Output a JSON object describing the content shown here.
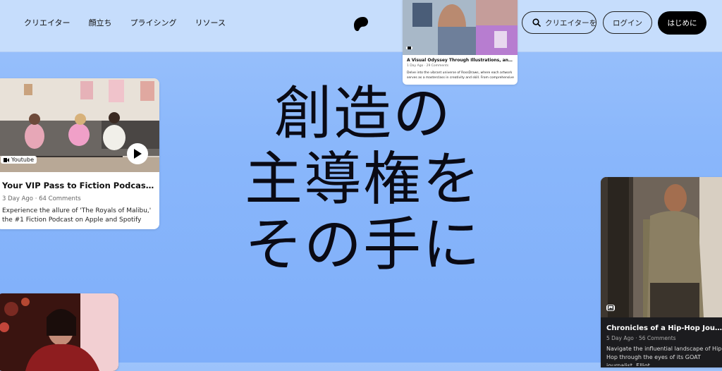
{
  "nav": {
    "items": [
      {
        "label": "クリエイター"
      },
      {
        "label": "顔立ち"
      },
      {
        "label": "プライシング"
      },
      {
        "label": "リソース"
      }
    ]
  },
  "header": {
    "search_placeholder": "クリエイターを...",
    "login_label": "ログイン",
    "start_label": "はじめに"
  },
  "hero": {
    "lines": [
      "創造の",
      "主導権を",
      "その手に"
    ]
  },
  "cards": {
    "left": {
      "badge": "Youtube",
      "title": "Your VIP Pass to Fiction Podcast Royalty",
      "meta": "3 Day Ago · 64 Comments",
      "desc": "Experience the allure of 'The Royals of Malibu,' the #1 Fiction Podcast on Apple and Spotify that keep..."
    },
    "top": {
      "badge": "",
      "title": "A Visual Odyssey Through Illustrations, and Character...",
      "meta": "1 Day Ago · 29 Comments",
      "desc": "Delve into the vibrant universe of RossDraws, where each artwork serves as a masterclass in creativity and skill. From comprehensive art courses..."
    },
    "right": {
      "title": "Chronicles of a Hip-Hop Journalis...",
      "meta": "5 Day Ago · 56 Comments",
      "desc": "Navigate the influential landscape of Hip-Hop through the eyes of its GOAT journalist, Elliot..."
    }
  },
  "colors": {
    "header_bg": "#c6ddfc",
    "page_bg": "#8ab7fb",
    "accent": "#000000"
  }
}
